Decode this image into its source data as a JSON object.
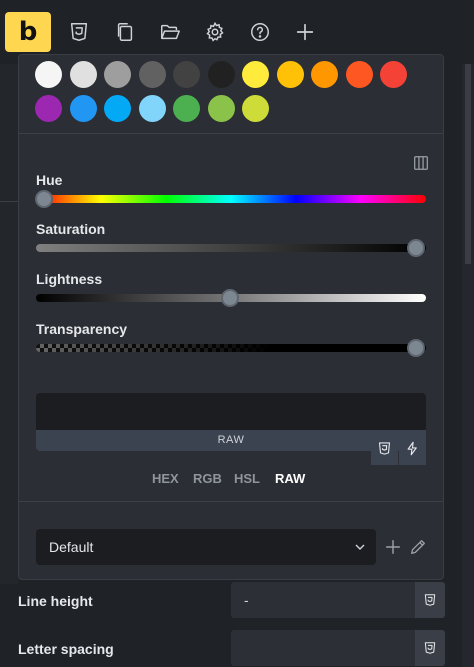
{
  "toolbar": {
    "logo": "b",
    "icons": [
      "css3-icon",
      "copy-pages-icon",
      "folder-open-icon",
      "gear-icon",
      "help-icon",
      "plus-icon"
    ]
  },
  "colors": {
    "accent": "#ffd64f",
    "panel_bg": "#2b2e34",
    "swatches_row1": [
      "#f5f5f5",
      "#e0e0e0",
      "#9e9e9e",
      "#616161",
      "#424242",
      "#212121",
      "#ffeb3b",
      "#ffc107",
      "#ff9800",
      "#ff5722",
      "#f44336"
    ],
    "swatches_row2": [
      "#9c27b0",
      "#2196f3",
      "#03a9f4",
      "#81d4fa",
      "#4caf50",
      "#8bc34a",
      "#cddc39"
    ]
  },
  "color_picker": {
    "hue_label": "Hue",
    "saturation_label": "Saturation",
    "lightness_label": "Lightness",
    "transparency_label": "Transparency",
    "hue_value": 0,
    "saturation_value": 1.0,
    "lightness_value": 0.5,
    "transparency_value": 1.0,
    "raw_label": "RAW",
    "formats": [
      "HEX",
      "RGB",
      "HSL",
      "RAW"
    ],
    "active_format": "RAW"
  },
  "palette_select": {
    "value": "Default"
  },
  "properties": [
    {
      "label": "Line height",
      "value": "-"
    },
    {
      "label": "Letter spacing",
      "value": ""
    }
  ]
}
